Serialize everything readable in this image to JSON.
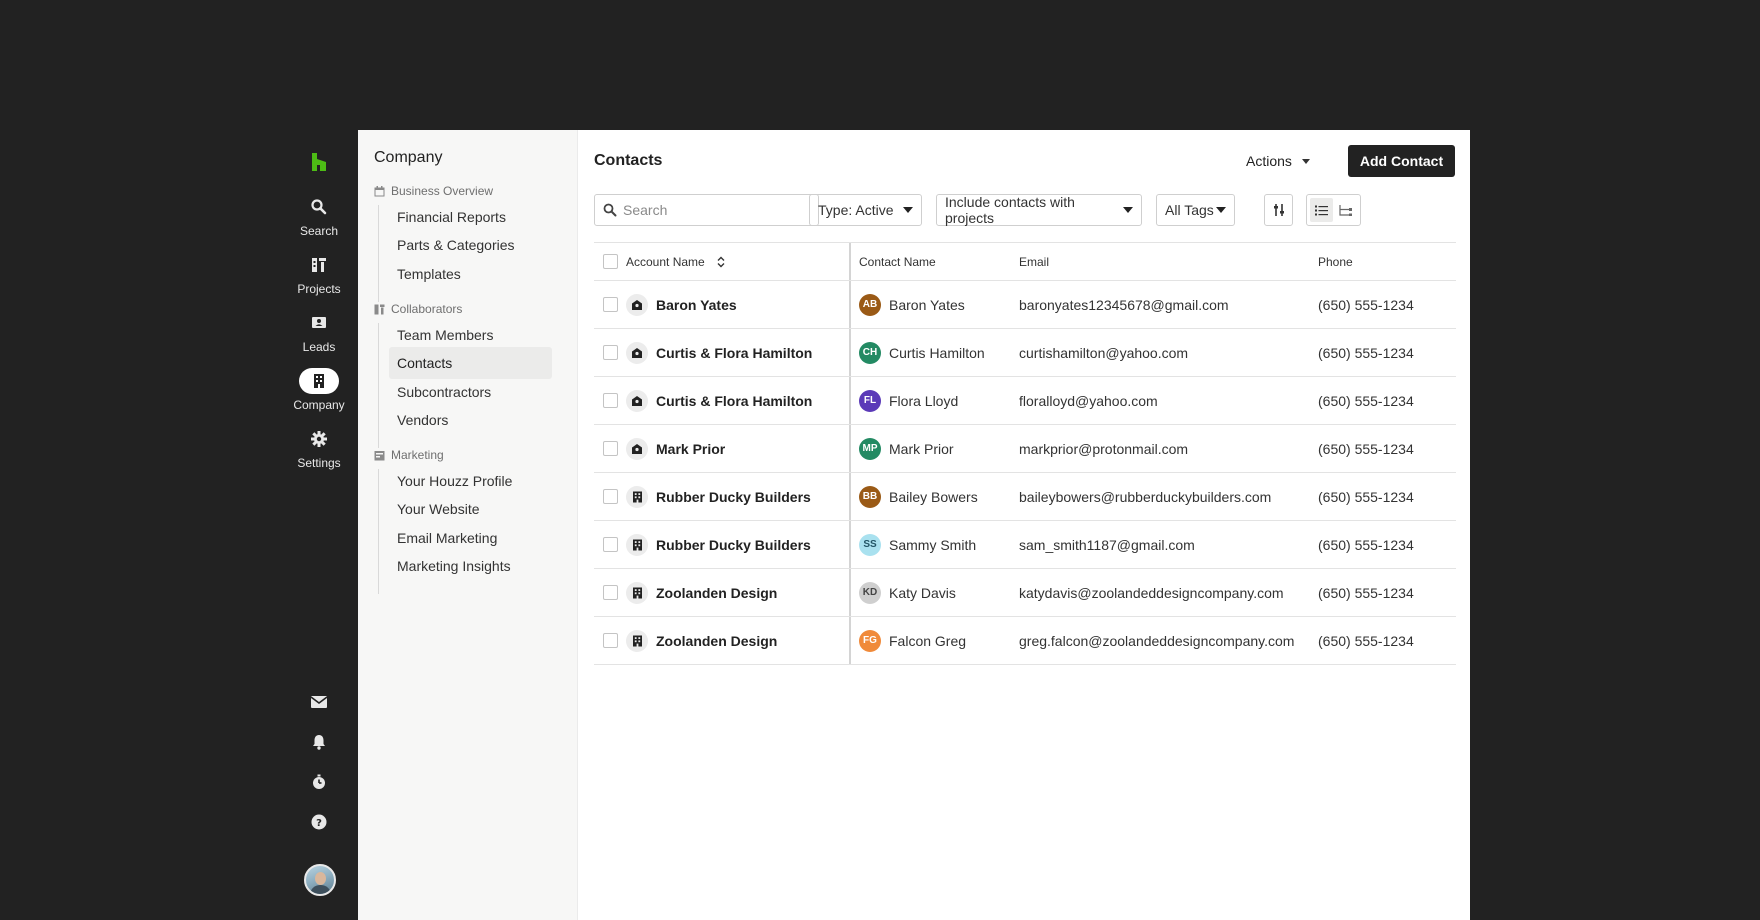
{
  "rail": {
    "logo": "houzz-logo-icon",
    "items": [
      {
        "label": "Search",
        "icon": "search-icon"
      },
      {
        "label": "Projects",
        "icon": "projects-icon"
      },
      {
        "label": "Leads",
        "icon": "leads-icon"
      },
      {
        "label": "Company",
        "icon": "company-icon",
        "active": true
      },
      {
        "label": "Settings",
        "icon": "gear-icon"
      }
    ],
    "bottom_icons": [
      "mail-icon",
      "bell-icon",
      "timer-icon",
      "help-icon"
    ],
    "avatar": "user-avatar"
  },
  "subnav": {
    "title": "Company",
    "sections": [
      {
        "label": "Business Overview",
        "items": [
          "Financial Reports",
          "Parts & Categories",
          "Templates"
        ]
      },
      {
        "label": "Collaborators",
        "items": [
          "Team Members",
          "Contacts",
          "Subcontractors",
          "Vendors"
        ]
      },
      {
        "label": "Marketing",
        "items": [
          "Your Houzz Profile",
          "Your Website",
          "Email Marketing",
          "Marketing Insights"
        ]
      }
    ],
    "active_item": "Contacts"
  },
  "main": {
    "title": "Contacts",
    "actions_label": "Actions",
    "add_label": "Add Contact",
    "search_placeholder": "Search",
    "filters": {
      "type": "Type: Active",
      "projects": "Include contacts with projects",
      "tags": "All Tags"
    }
  },
  "table": {
    "columns": {
      "account": "Account Name",
      "contact": "Contact Name",
      "email": "Email",
      "phone": "Phone"
    },
    "rows": [
      {
        "account": "Baron Yates",
        "account_type": "person",
        "initials": "AB",
        "avatar_color": "#9a5a16",
        "contact": "Baron Yates",
        "email": "baronyates12345678@gmail.com",
        "phone": "(650) 555-1234"
      },
      {
        "account": "Curtis & Flora Hamilton",
        "account_type": "person",
        "initials": "CH",
        "avatar_color": "#238a63",
        "contact": "Curtis Hamilton",
        "email": "curtishamilton@yahoo.com",
        "phone": "(650) 555-1234"
      },
      {
        "account": "Curtis & Flora Hamilton",
        "account_type": "person",
        "initials": "FL",
        "avatar_color": "#5b3ab8",
        "contact": "Flora Lloyd",
        "email": "floralloyd@yahoo.com",
        "phone": "(650) 555-1234"
      },
      {
        "account": "Mark Prior",
        "account_type": "person",
        "initials": "MP",
        "avatar_color": "#238a63",
        "contact": "Mark Prior",
        "email": "markprior@protonmail.com",
        "phone": "(650) 555-1234"
      },
      {
        "account": "Rubber Ducky Builders",
        "account_type": "company",
        "initials": "BB",
        "avatar_color": "#9a5a16",
        "contact": "Bailey Bowers",
        "email": "baileybowers@rubberduckybuilders.com",
        "phone": "(650) 555-1234"
      },
      {
        "account": "Rubber Ducky Builders",
        "account_type": "company",
        "initials": "SS",
        "avatar_color": "#a9e1ef",
        "initials_color": "#225566",
        "contact": "Sammy Smith",
        "email": "sam_smith1187@gmail.com",
        "phone": "(650) 555-1234"
      },
      {
        "account": "Zoolanden Design",
        "account_type": "company",
        "initials": "KD",
        "avatar_color": "#cfcfcf",
        "initials_color": "#444444",
        "contact": "Katy Davis",
        "email": "katydavis@zoolandeddesigncompany.com",
        "phone": "(650) 555-1234"
      },
      {
        "account": "Zoolanden Design",
        "account_type": "company",
        "initials": "FG",
        "avatar_color": "#f08a3a",
        "contact": "Falcon Greg",
        "email": "greg.falcon@zoolandeddesigncompany.com",
        "phone": "(650) 555-1234"
      }
    ]
  },
  "colors": {
    "brand": "#4dbc15",
    "page_bg": "#222222",
    "primary_button": "#222222"
  }
}
